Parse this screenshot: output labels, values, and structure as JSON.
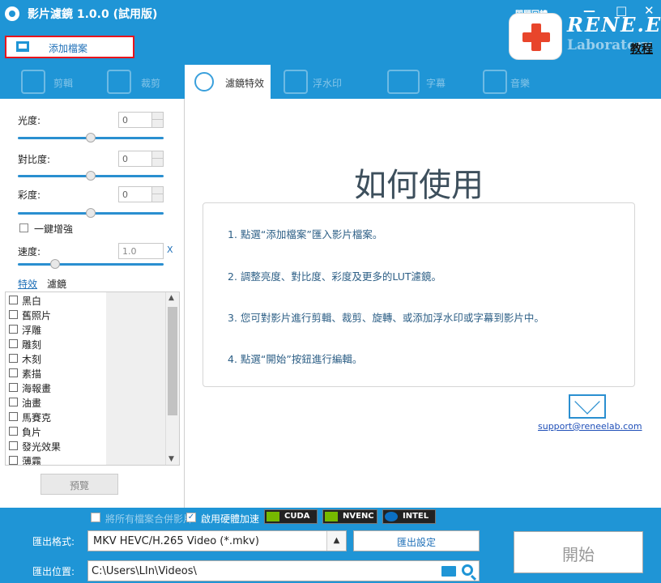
{
  "app": {
    "title": "影片濾鏡 1.0.0 (試用版)",
    "help_label": "問題回饋",
    "brand": "RENE.E",
    "brand_sub": "Laboratory",
    "tutorial": "教程",
    "window_controls": [
      "—",
      "□",
      "✕"
    ]
  },
  "toolbar": {
    "add_file": "添加檔案"
  },
  "tabs": [
    {
      "label": "剪輯",
      "icon": "scissors-icon",
      "active": false
    },
    {
      "label": "裁剪",
      "icon": "crop-icon",
      "active": false
    },
    {
      "label": "濾鏡特效",
      "icon": "magic-wand-icon",
      "active": true
    },
    {
      "label": "浮水印",
      "icon": "watermark-icon",
      "active": false
    },
    {
      "label": "字幕",
      "icon": "subtitle-icon",
      "active": false
    },
    {
      "label": "音樂",
      "icon": "music-icon",
      "active": false
    }
  ],
  "adjust": {
    "brightness": {
      "label": "光度:",
      "value": "0",
      "slider_fraction": 0.5
    },
    "contrast": {
      "label": "對比度:",
      "value": "0",
      "slider_fraction": 0.5
    },
    "saturation": {
      "label": "彩度:",
      "value": "0",
      "slider_fraction": 0.5
    },
    "one_click": {
      "label": "一鍵增強",
      "checked": false
    },
    "speed": {
      "label": "速度:",
      "value": "1.0",
      "unit": "X",
      "slider_fraction": 0.25
    }
  },
  "subtabs": {
    "effect": "特效",
    "filter": "濾鏡"
  },
  "effects": [
    "黑白",
    "舊照片",
    "浮雕",
    "雕刻",
    "木刻",
    "素描",
    "海報畫",
    "油畫",
    "馬賽克",
    "負片",
    "發光效果",
    "薄霧"
  ],
  "preview_button": "預覽",
  "howto": {
    "title": "如何使用",
    "steps": [
      "1. 點選“添加檔案”匯入影片檔案。",
      "2. 調整亮度、對比度、彩度及更多的LUT濾鏡。",
      "3. 您可對影片進行剪輯、裁剪、旋轉、或添加浮水印或字幕到影片中。",
      "4. 點選“開始”按鈕進行編輯。"
    ],
    "support_email": "support@reneelab.com"
  },
  "bottom": {
    "merge_label": "將所有檔案合併影片",
    "hw_accel_label": "啟用硬體加速",
    "hw_accel_checked": true,
    "badges": [
      "CUDA",
      "NVENC",
      "INTEL"
    ],
    "format_label": "匯出格式:",
    "format_value": "MKV HEVC/H.265 Video (*.mkv)",
    "export_settings": "匯出設定",
    "location_label": "匯出位置:",
    "location_value": "C:\\Users\\LIn\\Videos\\",
    "start": "開始"
  },
  "colors": {
    "accent": "#1f95d6",
    "highlight_border": "#e8141d",
    "brand_red": "#e8452b"
  }
}
